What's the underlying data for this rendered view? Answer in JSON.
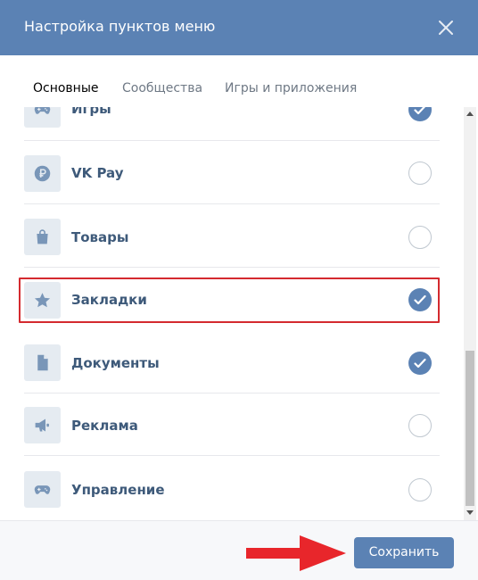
{
  "dialog": {
    "title": "Настройка пунктов меню",
    "close_icon": "close-icon"
  },
  "tabs": [
    {
      "label": "Основные",
      "active": true
    },
    {
      "label": "Сообщества",
      "active": false
    },
    {
      "label": "Игры и приложения",
      "active": false
    }
  ],
  "items": [
    {
      "label": "Игры",
      "icon": "gamepad-icon",
      "checked": true
    },
    {
      "label": "VK Pay",
      "icon": "ruble-coin-icon",
      "checked": false
    },
    {
      "label": "Товары",
      "icon": "shopping-bag-icon",
      "checked": false
    },
    {
      "label": "Закладки",
      "icon": "star-icon",
      "checked": true,
      "highlighted": true
    },
    {
      "label": "Документы",
      "icon": "document-icon",
      "checked": true
    },
    {
      "label": "Реклама",
      "icon": "megaphone-icon",
      "checked": false
    },
    {
      "label": "Управление",
      "icon": "gamepad-icon",
      "checked": false
    }
  ],
  "footer": {
    "save_label": "Сохранить"
  },
  "colors": {
    "header_bg": "#5b82b4",
    "accent": "#5b82b4",
    "label_text": "#3e5a7a",
    "highlight_border": "#d42a2f",
    "arrow": "#e8262b"
  }
}
